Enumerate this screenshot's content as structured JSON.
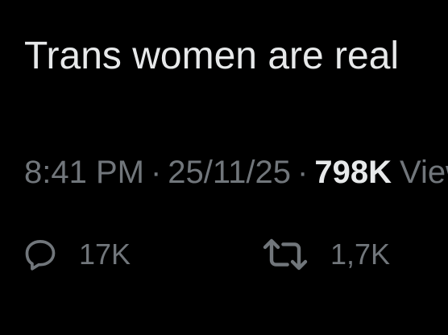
{
  "post": {
    "text": "Trans women are real"
  },
  "meta": {
    "time": "8:41 PM",
    "separator": "·",
    "date": "25/11/25",
    "views_count": "798K",
    "views_label": "Views"
  },
  "actions": {
    "replies": {
      "icon": "reply-icon",
      "count": "17K"
    },
    "reposts": {
      "icon": "repost-icon",
      "count": "1,7K"
    }
  },
  "colors": {
    "background": "#000000",
    "primary_text": "#e7e9ea",
    "secondary_text": "#71767b"
  }
}
